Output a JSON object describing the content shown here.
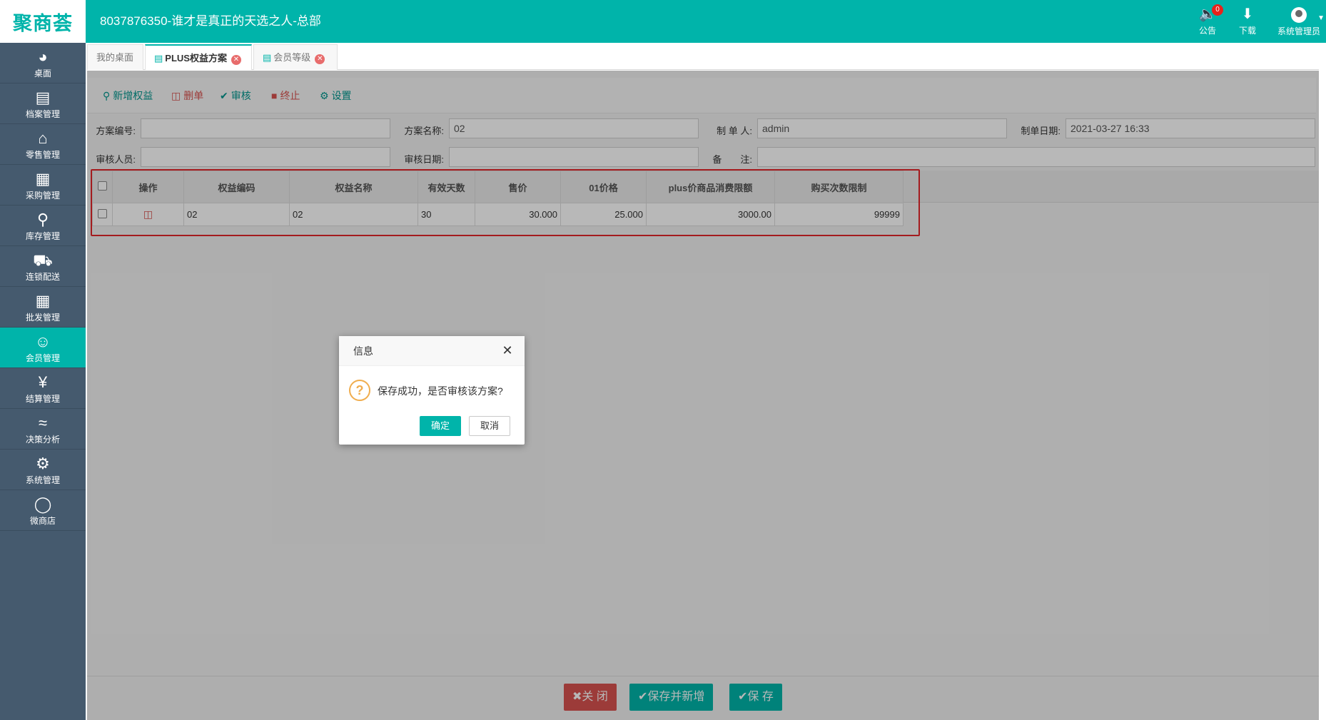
{
  "header": {
    "logo_text": "聚商荟",
    "title": "8037876350-谁才是真正的天选之人-总部",
    "notice": {
      "label": "公告",
      "badge": "0"
    },
    "download": {
      "label": "下载"
    },
    "user": {
      "label": "系统管理员"
    }
  },
  "sidebar": {
    "items": [
      {
        "label": "桌面",
        "icon": "dashboard-icon"
      },
      {
        "label": "档案管理",
        "icon": "archive-icon"
      },
      {
        "label": "零售管理",
        "icon": "store-icon"
      },
      {
        "label": "采购管理",
        "icon": "cart-icon"
      },
      {
        "label": "库存管理",
        "icon": "inventory-icon"
      },
      {
        "label": "连锁配送",
        "icon": "truck-icon"
      },
      {
        "label": "批发管理",
        "icon": "wholesale-icon"
      },
      {
        "label": "会员管理",
        "icon": "member-icon"
      },
      {
        "label": "结算管理",
        "icon": "settlement-icon"
      },
      {
        "label": "决策分析",
        "icon": "chart-icon"
      },
      {
        "label": "系统管理",
        "icon": "gear-icon"
      },
      {
        "label": "微商店",
        "icon": "shop-bag-icon"
      }
    ],
    "active_index": 7
  },
  "tabs": [
    {
      "label": "我的桌面"
    },
    {
      "label": "PLUS权益方案"
    },
    {
      "label": "会员等级"
    }
  ],
  "toolbar": {
    "add": "新增权益",
    "delete": "删单",
    "audit": "审核",
    "stop": "终止",
    "settings": "设置"
  },
  "form": {
    "plan_no_label": "方案编号:",
    "plan_no_value": "",
    "plan_name_label": "方案名称:",
    "plan_name_value": "02",
    "creator_label": "制 单 人:",
    "creator_value": "admin",
    "create_date_label": "制单日期:",
    "create_date_value": "2021-03-27 16:33",
    "auditor_label": "审核人员:",
    "auditor_value": "",
    "audit_date_label": "审核日期:",
    "audit_date_value": "",
    "remark_label": "备　　注:",
    "remark_value": ""
  },
  "grid": {
    "columns": [
      "操作",
      "权益编码",
      "权益名称",
      "有效天数",
      "售价",
      "01价格",
      "plus价商品消费限额",
      "购买次数限制"
    ],
    "rows": [
      {
        "code": "02",
        "name": "02",
        "days": "30",
        "price": "30.000",
        "price01": "25.000",
        "limit": "3000.00",
        "times": "99999"
      }
    ]
  },
  "footer": {
    "close": "关 闭",
    "save_new": "保存并新增",
    "save": "保 存"
  },
  "dialog": {
    "title": "信息",
    "message": "保存成功，是否审核该方案?",
    "ok": "确定",
    "cancel": "取消"
  },
  "colors": {
    "brand": "#00b4aa",
    "sidebar": "#455a6e",
    "danger": "#d9534f",
    "highlight_border": "#e3262a"
  }
}
